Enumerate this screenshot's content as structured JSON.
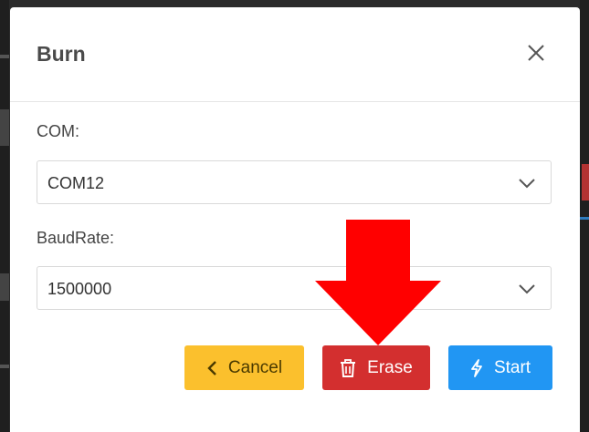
{
  "modal": {
    "title": "Burn"
  },
  "fields": {
    "com": {
      "label": "COM:",
      "value": "COM12"
    },
    "baudrate": {
      "label": "BaudRate:",
      "value": "1500000"
    }
  },
  "buttons": {
    "cancel": "Cancel",
    "erase": "Erase",
    "start": "Start"
  },
  "icons": {
    "close": "close-icon",
    "chevron": "chevron-down-icon",
    "cancel": "chevron-left-icon",
    "erase": "trash-icon",
    "start": "lightning-icon",
    "annotation": "red-arrow-down"
  },
  "colors": {
    "cancel": "#fbc02d",
    "erase": "#d32f2f",
    "start": "#2196f3",
    "annotation_arrow": "#ff0000"
  }
}
